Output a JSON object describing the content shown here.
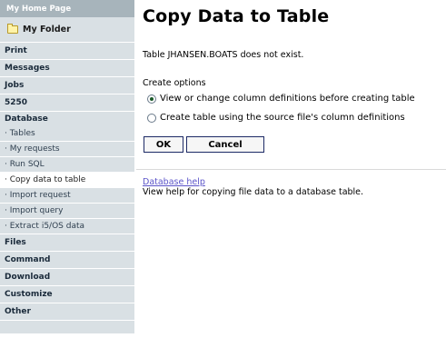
{
  "sidebar": {
    "home": "My Home Page",
    "folder": "My Folder",
    "items": [
      {
        "label": "Print"
      },
      {
        "label": "Messages"
      },
      {
        "label": "Jobs"
      },
      {
        "label": "5250"
      },
      {
        "label": "Database"
      }
    ],
    "database_sub": [
      {
        "label": "· Tables"
      },
      {
        "label": "· My requests"
      },
      {
        "label": "· Run SQL"
      },
      {
        "label": "· Copy data to table"
      },
      {
        "label": "· Import request"
      },
      {
        "label": "· Import query"
      },
      {
        "label": "· Extract i5/OS data"
      }
    ],
    "items2": [
      {
        "label": "Files"
      },
      {
        "label": "Command"
      },
      {
        "label": "Download"
      },
      {
        "label": "Customize"
      },
      {
        "label": "Other"
      }
    ]
  },
  "main": {
    "title": "Copy Data to Table",
    "message": "Table JHANSEN.BOATS does not exist.",
    "options_label": "Create options",
    "options": [
      {
        "label": "View or change column definitions before creating table",
        "selected": true
      },
      {
        "label": "Create table using the source file's column definitions",
        "selected": false
      }
    ],
    "ok_label": "OK",
    "cancel_label": "Cancel",
    "help_link": "Database help",
    "help_desc": "View help for copying file data to a database table."
  },
  "colors": {
    "sidebar_header": "#a7b4bb",
    "sidebar_bg": "#d9e0e4",
    "link": "#5b54c9",
    "button_border": "#1d2a66"
  }
}
